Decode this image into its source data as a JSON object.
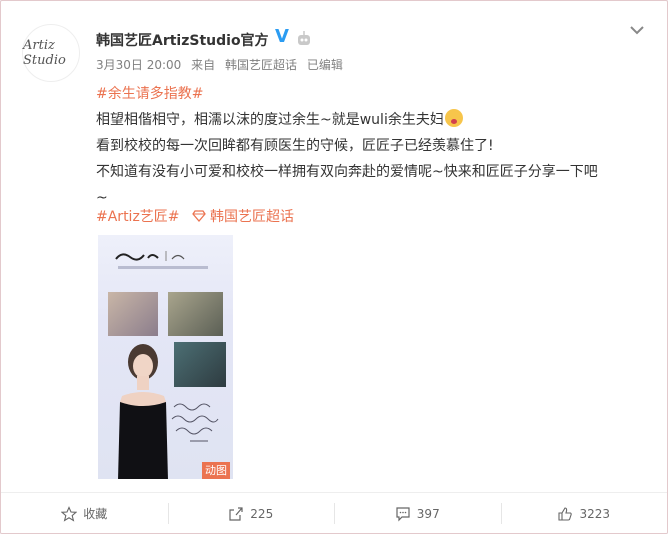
{
  "post": {
    "author": "韩国艺匠ArtizStudio官方",
    "avatar_text": "Artiz Studio",
    "time": "3月30日 20:00",
    "source_prefix": "来自",
    "source": "韩国艺匠超话",
    "edited": "已编辑",
    "lines": [
      "#余生请多指教#",
      "相望相偕相守，相濡以沫的度过余生~就是wuli余生夫妇",
      "看到校校的每一次回眸都有顾医生的守候，匠匠子已经羡慕住了!",
      "不知道有没有小可爱和校校一样拥有双向奔赴的爱情呢~快来和匠匠子分享一下吧",
      "~"
    ],
    "topic_tag": "#Artiz艺匠#",
    "super_topic": "韩国艺匠超话",
    "media_badge": "动图"
  },
  "actions": {
    "collect": "收藏",
    "repost": "225",
    "comment": "397",
    "like": "3223"
  },
  "colors": {
    "accent": "#eb7350",
    "verified": "#2b9cf2"
  }
}
